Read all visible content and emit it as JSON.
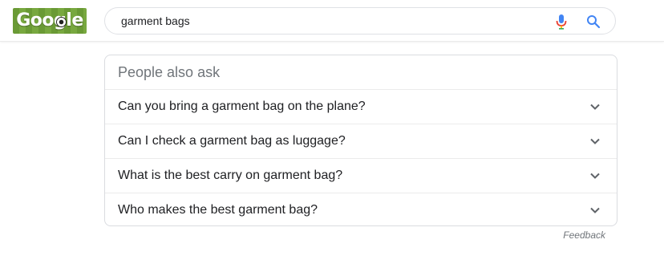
{
  "header": {
    "logo_text": "Google",
    "search": {
      "value": "garment bags"
    }
  },
  "paa": {
    "title": "People also ask",
    "questions": [
      "Can you bring a garment bag on the plane?",
      "Can I check a garment bag as luggage?",
      "What is the best carry on garment bag?",
      "Who makes the best garment bag?"
    ]
  },
  "footer": {
    "feedback_label": "Feedback"
  },
  "colors": {
    "accent_blue": "#4285f4",
    "mic_red": "#ea4335",
    "mic_yellow": "#fbbc05",
    "mic_green": "#34a853",
    "logo_green": "#6a9a35"
  },
  "icons": {
    "mic": "microphone-icon",
    "search": "search-icon",
    "expand": "chevron-down-icon"
  }
}
